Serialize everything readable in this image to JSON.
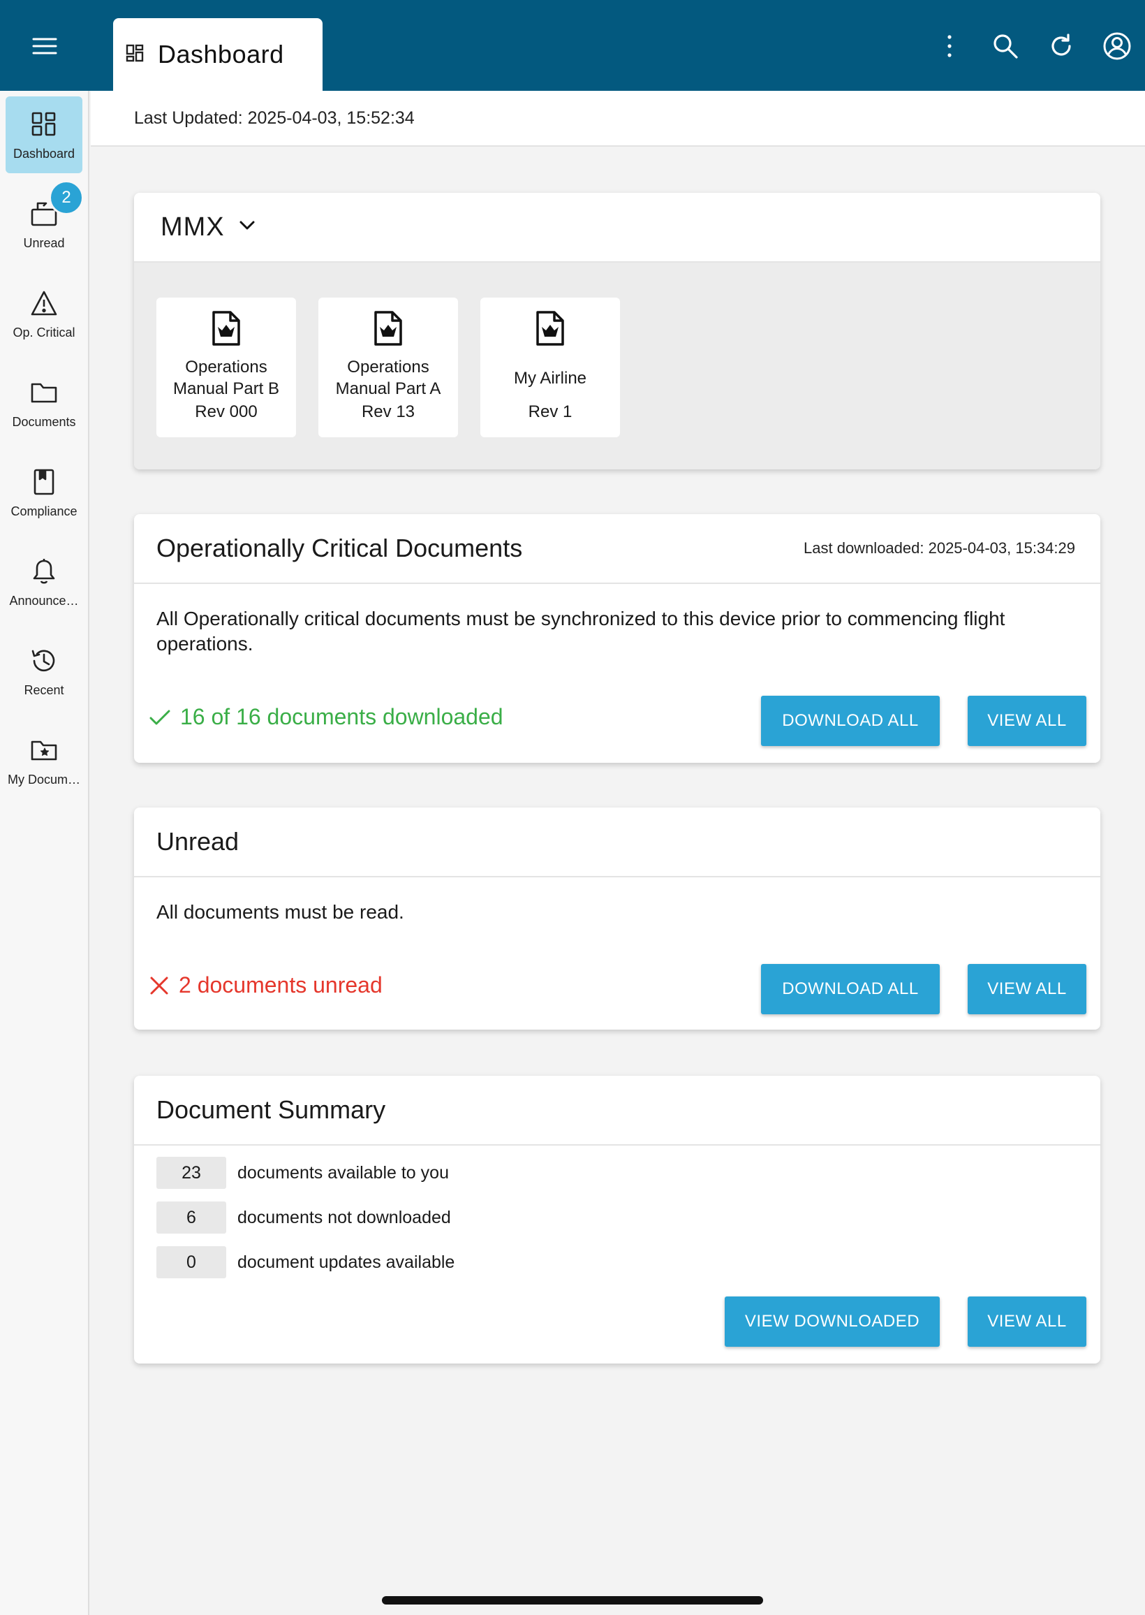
{
  "app": {
    "tab_title": "Dashboard",
    "icons": {
      "menu": "hamburger-icon",
      "tab": "dashboard-icon",
      "more": "more-vertical-icon",
      "search": "search-icon",
      "refresh": "refresh-icon",
      "account": "account-icon"
    },
    "colors": {
      "topbar": "#03597f",
      "accent": "#2aa3d5",
      "active_nav": "#a7dcef",
      "success": "#3aae47",
      "error": "#e5372c"
    }
  },
  "sidebar": {
    "items": [
      {
        "label": "Dashboard",
        "icon": "dashboard-icon",
        "active": true
      },
      {
        "label": "Unread",
        "icon": "unread-icon",
        "badge": "2"
      },
      {
        "label": "Op. Critical",
        "icon": "warning-icon"
      },
      {
        "label": "Documents",
        "icon": "folder-icon"
      },
      {
        "label": "Compliance",
        "icon": "compliance-icon"
      },
      {
        "label": "Announce…",
        "icon": "bell-icon"
      },
      {
        "label": "Recent",
        "icon": "history-icon"
      },
      {
        "label": "My Docum…",
        "icon": "star-folder-icon"
      }
    ]
  },
  "status": {
    "last_updated": "Last Updated: 2025-04-03, 15:52:34"
  },
  "mmx": {
    "selector": "MMX",
    "documents": [
      {
        "name": "Operations Manual Part B",
        "rev": "Rev 000"
      },
      {
        "name": "Operations Manual Part A",
        "rev": "Rev 13"
      },
      {
        "name": "My Airline",
        "rev": "Rev 1"
      }
    ]
  },
  "op_critical": {
    "title": "Operationally Critical Documents",
    "last_downloaded": "Last downloaded: 2025-04-03, 15:34:29",
    "description": "All Operationally critical documents must be synchronized to this device prior to commencing flight operations.",
    "status": "16 of 16 documents downloaded",
    "download_label": "DOWNLOAD ALL",
    "view_label": "VIEW ALL"
  },
  "unread": {
    "title": "Unread",
    "description": "All documents must be read.",
    "status": "2 documents unread",
    "download_label": "DOWNLOAD ALL",
    "view_label": "VIEW ALL"
  },
  "summary": {
    "title": "Document Summary",
    "rows": [
      {
        "count": "23",
        "label": "documents available to you"
      },
      {
        "count": "6",
        "label": "documents not downloaded"
      },
      {
        "count": "0",
        "label": "document updates available"
      }
    ],
    "view_downloaded_label": "VIEW DOWNLOADED",
    "view_all_label": "VIEW ALL"
  }
}
